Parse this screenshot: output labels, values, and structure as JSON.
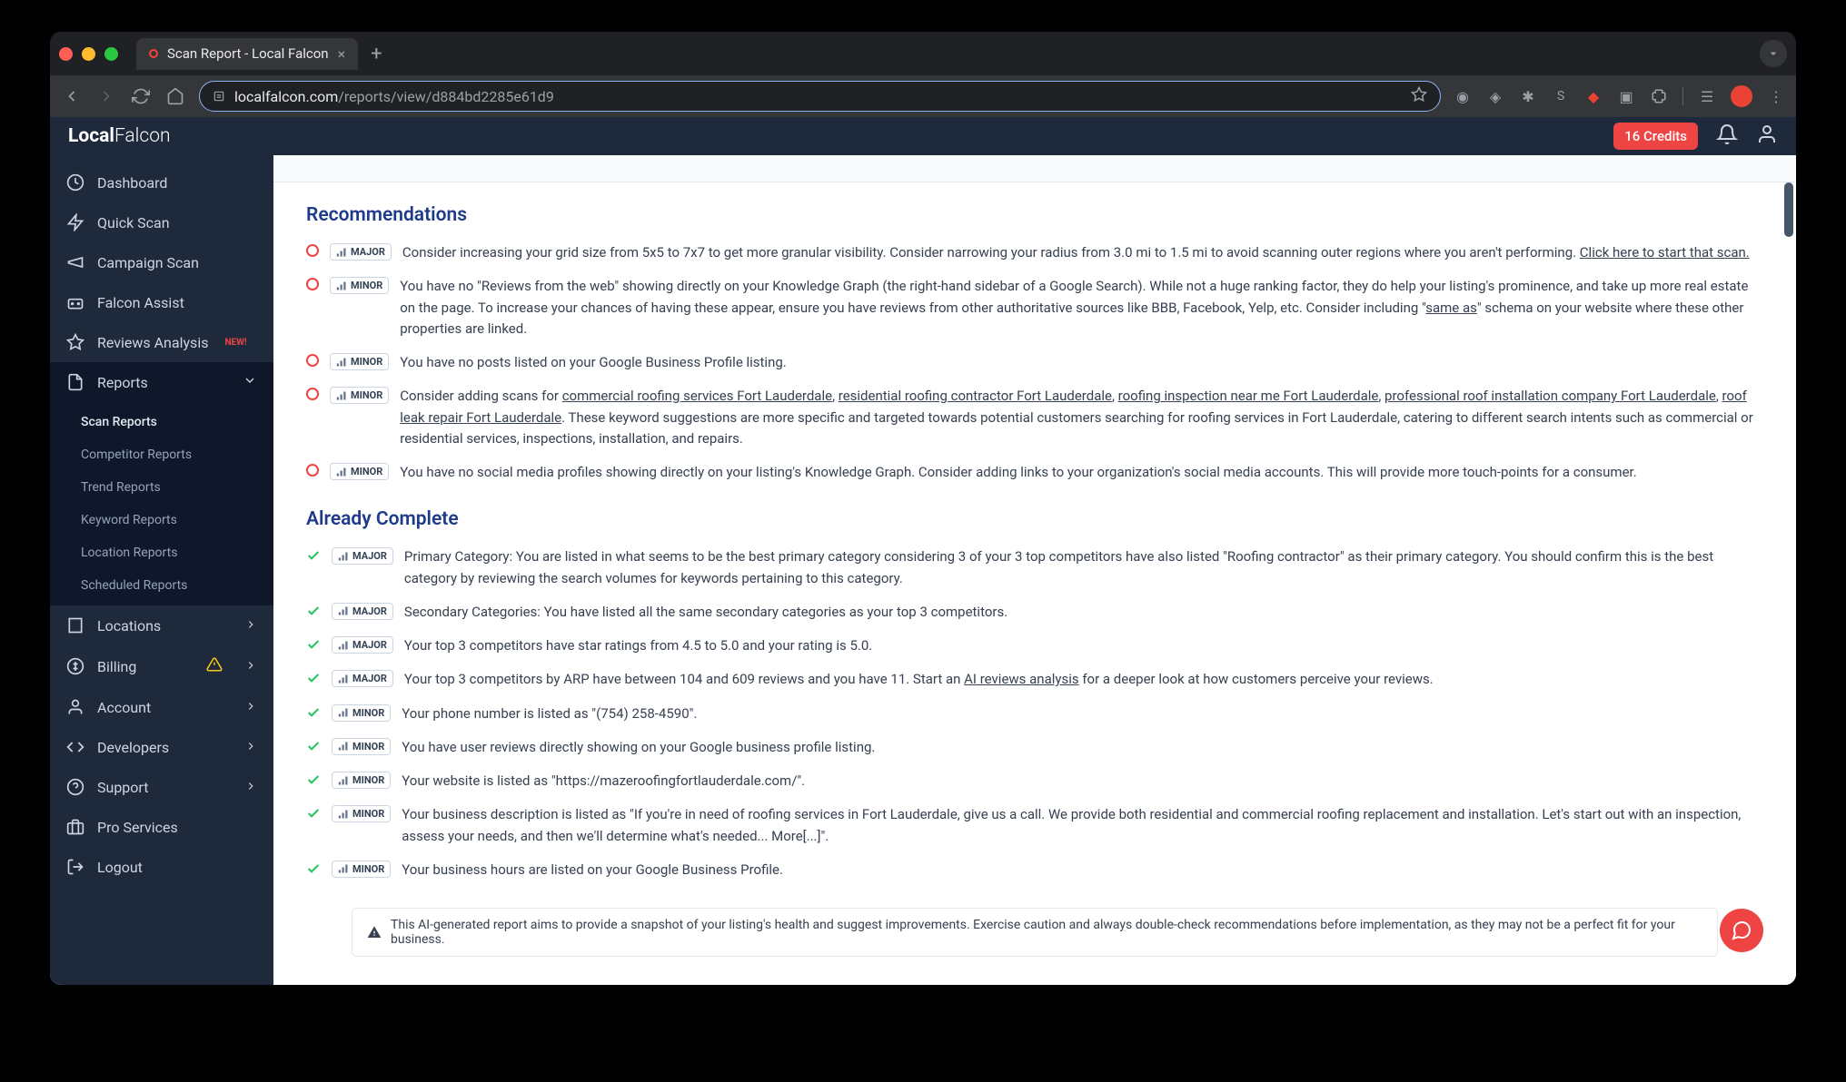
{
  "browser": {
    "tab_title": "Scan Report - Local Falcon",
    "url_domain": "localfalcon.com",
    "url_path": "/reports/view/d884bd2285e61d9"
  },
  "header": {
    "logo_bold": "Local",
    "logo_light": "Falcon",
    "credits": "16 Credits"
  },
  "sidebar": {
    "items": [
      {
        "label": "Dashboard"
      },
      {
        "label": "Quick Scan"
      },
      {
        "label": "Campaign Scan"
      },
      {
        "label": "Falcon Assist"
      },
      {
        "label": "Reviews Analysis",
        "badge": "NEW!"
      },
      {
        "label": "Reports"
      },
      {
        "label": "Locations"
      },
      {
        "label": "Billing"
      },
      {
        "label": "Account"
      },
      {
        "label": "Developers"
      },
      {
        "label": "Support"
      },
      {
        "label": "Pro Services"
      },
      {
        "label": "Logout"
      }
    ],
    "subnav": [
      {
        "label": "Scan Reports"
      },
      {
        "label": "Competitor Reports"
      },
      {
        "label": "Trend Reports"
      },
      {
        "label": "Keyword Reports"
      },
      {
        "label": "Location Reports"
      },
      {
        "label": "Scheduled Reports"
      }
    ]
  },
  "content": {
    "recommendations_title": "Recommendations",
    "already_complete_title": "Already Complete",
    "recommendations": [
      {
        "severity": "MAJOR",
        "text_before": "Consider increasing your grid size from 5x5 to 7x7 to get more granular visibility. Consider narrowing your radius from 3.0 mi to 1.5 mi to avoid scanning outer regions where you aren't performing. ",
        "links": [
          {
            "text": "Click here to start that scan."
          }
        ]
      },
      {
        "severity": "MINOR",
        "text_before": "You have no \"Reviews from the web\" showing directly on your Knowledge Graph (the right-hand sidebar of a Google Search). While not a huge ranking factor, they do help your listing's prominence, and take up more real estate on the page. To increase your chances of having these appear, ensure you have reviews from other authoritative sources like BBB, Facebook, Yelp, etc. Consider including \"",
        "links": [
          {
            "text": "same as"
          }
        ],
        "text_after": "\" schema on your website where these other properties are linked."
      },
      {
        "severity": "MINOR",
        "text_before": "You have no posts listed on your Google Business Profile listing."
      },
      {
        "severity": "MINOR",
        "text_before": "Consider adding scans for ",
        "links": [
          {
            "text": "commercial roofing services Fort Lauderdale"
          },
          {
            "text": "residential roofing contractor Fort Lauderdale"
          },
          {
            "text": "roofing inspection near me Fort Lauderdale"
          },
          {
            "text": "professional roof installation company Fort Lauderdale"
          },
          {
            "text": "roof leak repair Fort Lauderdale"
          }
        ],
        "text_after": ". These keyword suggestions are more specific and targeted towards potential customers searching for roofing services in Fort Lauderdale, catering to different search intents such as commercial or residential services, inspections, installation, and repairs."
      },
      {
        "severity": "MINOR",
        "text_before": "You have no social media profiles showing directly on your listing's Knowledge Graph. Consider adding links to your organization's social media accounts. This will provide more touch-points for a consumer."
      }
    ],
    "completed": [
      {
        "severity": "MAJOR",
        "text": "Primary Category: You are listed in what seems to be the best primary category considering 3 of your 3 top competitors have also listed \"Roofing contractor\" as their primary category. You should confirm this is the best category by reviewing the search volumes for keywords pertaining to this category."
      },
      {
        "severity": "MAJOR",
        "text": "Secondary Categories: You have listed all the same secondary categories as your top 3 competitors."
      },
      {
        "severity": "MAJOR",
        "text": "Your top 3 competitors have star ratings from 4.5 to 5.0 and your rating is 5.0."
      },
      {
        "severity": "MAJOR",
        "text_before": "Your top 3 competitors by ARP have between 104 and 609 reviews and you have 11. Start an ",
        "link": "AI reviews analysis",
        "text_after": " for a deeper look at how customers perceive your reviews."
      },
      {
        "severity": "MINOR",
        "text": "Your phone number is listed as \"(754) 258-4590\"."
      },
      {
        "severity": "MINOR",
        "text": "You have user reviews directly showing on your Google business profile listing."
      },
      {
        "severity": "MINOR",
        "text": "Your website is listed as \"https://mazeroofingfortlauderdale.com/\"."
      },
      {
        "severity": "MINOR",
        "text": "Your business description is listed as \"If you're in need of roofing services in Fort Lauderdale, give us a call. We provide both residential and commercial roofing replacement and installation. Let's start out with an inspection, assess your needs, and then we'll determine what's needed... More[...]\"."
      },
      {
        "severity": "MINOR",
        "text": "Your business hours are listed on your Google Business Profile."
      }
    ],
    "disclaimer": "This AI-generated report aims to provide a snapshot of your listing's health and suggest improvements. Exercise caution and always double-check recommendations before implementation, as they may not be a perfect fit for your business."
  }
}
